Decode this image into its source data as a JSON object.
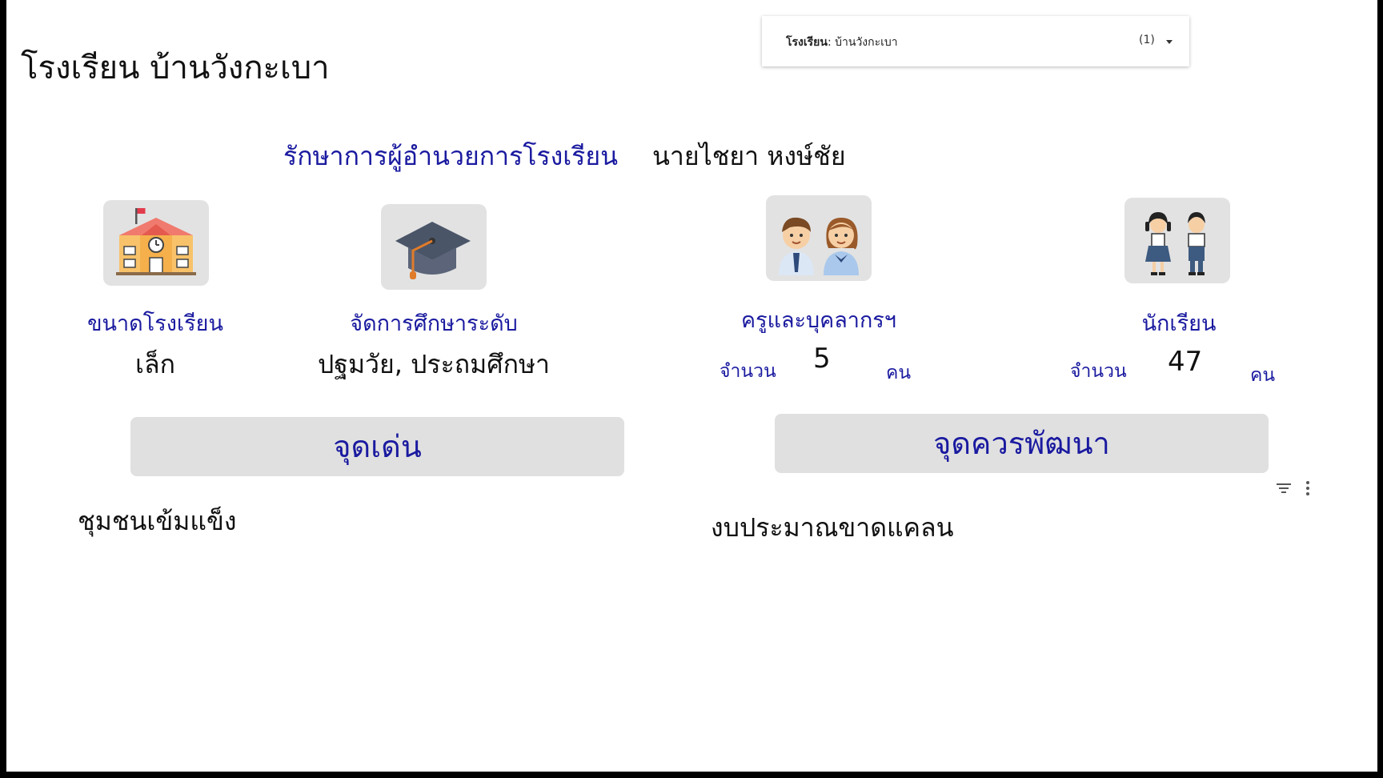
{
  "page": {
    "title": "โรงเรียน บ้านวังกะเบา"
  },
  "filter": {
    "label": "โรงเรียน",
    "value": ": บ้านวังกะเบา",
    "count": "(1)"
  },
  "director": {
    "role": "รักษาการผู้อำนวยการโรงเรียน",
    "name": "นายไชยา หงษ์ชัย"
  },
  "cards": {
    "school_size": {
      "icon": "school-building-icon",
      "label": "ขนาดโรงเรียน",
      "value": "เล็ก"
    },
    "education_level": {
      "icon": "graduation-cap-icon",
      "label": "จัดการศึกษาระดับ",
      "value": "ปฐมวัย, ประถมศึกษา"
    },
    "teachers": {
      "icon": "teachers-icon",
      "label": "ครูและบุคลากรฯ",
      "count_label": "จำนวน",
      "count": "5",
      "unit": "คน"
    },
    "students": {
      "icon": "students-icon",
      "label": "นักเรียน",
      "count_label": "จำนวน",
      "count": "47",
      "unit": "คน"
    }
  },
  "strengths": {
    "heading": "จุดเด่น",
    "text": "ชุมชนเข้มแข็ง"
  },
  "improvements": {
    "heading": "จุดควรพัฒนา",
    "text": "งบประมาณขาดแคลน"
  },
  "colors": {
    "accent": "#1a1aa0",
    "panel": "#e0e0e0",
    "icon_bg": "#e2e2e2"
  }
}
